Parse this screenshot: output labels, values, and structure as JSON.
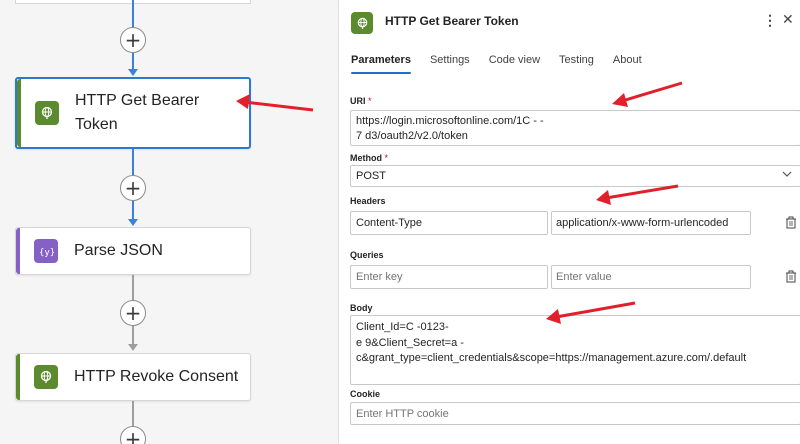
{
  "canvas": {
    "nodes": [
      {
        "title": "HTTP Get Bearer Token",
        "line1": "HTTP Get Bearer",
        "line2": "Token",
        "icon": "http-globe-icon",
        "color": "#5c8a2f",
        "selected": true
      },
      {
        "title": "Parse JSON",
        "icon": "braces-icon",
        "color": "#8661c5",
        "selected": false
      },
      {
        "title": "HTTP Revoke Consent",
        "icon": "http-globe-icon",
        "color": "#5c8a2f",
        "selected": false
      }
    ],
    "add_glyph": "+"
  },
  "panel": {
    "title": "HTTP Get Bearer Token",
    "more_glyph": "⋮",
    "close_glyph": "✕",
    "tabs": [
      {
        "label": "Parameters",
        "active": true
      },
      {
        "label": "Settings",
        "active": false
      },
      {
        "label": "Code view",
        "active": false
      },
      {
        "label": "Testing",
        "active": false
      },
      {
        "label": "About",
        "active": false
      }
    ],
    "uri": {
      "label": "URI",
      "required": "*",
      "line1": "https://login.microsoftonline.com/1C          -         -",
      "line2": "7         d3/oauth2/v2.0/token"
    },
    "method": {
      "label": "Method",
      "required": "*",
      "value": "POST"
    },
    "headers": {
      "label": "Headers",
      "key": "Content-Type",
      "value": "application/x-www-form-urlencoded"
    },
    "queries": {
      "label": "Queries",
      "key_placeholder": "Enter key",
      "value_placeholder": "Enter value"
    },
    "body": {
      "label": "Body",
      "line1": "Client_Id=C           -0123-",
      "line2": "e         9&Client_Secret=a                    -",
      "line3": "c&grant_type=client_credentials&scope=https://management.azure.com/.default"
    },
    "cookie": {
      "label": "Cookie",
      "placeholder": "Enter HTTP cookie"
    }
  },
  "colors": {
    "accent_blue": "#2b79d0",
    "http_green": "#5c8a2f",
    "parse_purple": "#8661c5",
    "annotation_red": "#e0202a"
  }
}
